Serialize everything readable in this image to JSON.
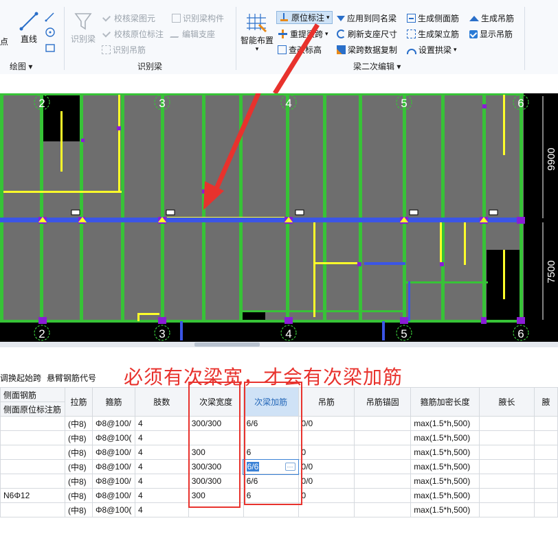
{
  "ribbon": {
    "groups": {
      "draw": {
        "label": "绘图",
        "items": {
          "line": "直线"
        },
        "partial_left": "点"
      },
      "identify": {
        "label": "识别梁",
        "items": {
          "identify_beam": "识别梁",
          "check_beam_graphic": "校核梁图元",
          "check_original_annotation": "校核原位标注",
          "identify_hanger": "识别吊筋",
          "identify_beam_component": "识别梁构件",
          "edit_support": "编辑支座"
        }
      },
      "secondary_edit": {
        "label": "梁二次编辑",
        "items": {
          "smart_layout": "智能布置",
          "original_annotation": "原位标注",
          "reextract_span": "重提梁跨",
          "check_elevation": "查改标高",
          "apply_same_name": "应用到同名梁",
          "refresh_support_size": "刷新支座尺寸",
          "copy_beam_data": "梁跨数据复制",
          "generate_side_rebar": "生成侧面筋",
          "generate_stand_rebar": "生成架立筋",
          "set_arch_beam": "设置拱梁",
          "generate_hanger": "生成吊筋",
          "show_hanger": "显示吊筋"
        }
      }
    }
  },
  "canvas": {
    "axis_labels_top": [
      "2",
      "3",
      "4",
      "5",
      "6"
    ],
    "axis_labels_bottom": [
      "2",
      "3",
      "4",
      "5",
      "6"
    ],
    "dimensions": [
      "9900",
      "7500"
    ]
  },
  "annotation": "必须有次梁宽，才会有次梁加筋",
  "grid": {
    "toolbar": [
      "调换起始跨",
      "悬臂钢筋代号"
    ],
    "group_header": "侧面钢筋",
    "columns": [
      "侧面原位标注筋",
      "拉筋",
      "箍筋",
      "肢数",
      "次梁宽度",
      "次梁加筋",
      "吊筋",
      "吊筋锚固",
      "箍筋加密长度",
      "腋长",
      "腋"
    ],
    "rows": [
      {
        "side": "",
        "tie": "(中8)",
        "stirrup": "Φ8@100/",
        "legs": "4",
        "sec_width": "300/300",
        "sec_rebar": "6/6",
        "hanger": "0/0",
        "anchor": "",
        "dense": "max(1.5*h,500)"
      },
      {
        "side": "",
        "tie": "(中8)",
        "stirrup": "Φ8@100(",
        "legs": "4",
        "sec_width": "",
        "sec_rebar": "",
        "hanger": "",
        "anchor": "",
        "dense": "max(1.5*h,500)"
      },
      {
        "side": "",
        "tie": "(中8)",
        "stirrup": "Φ8@100/",
        "legs": "4",
        "sec_width": "300",
        "sec_rebar": "6",
        "hanger": "0",
        "anchor": "",
        "dense": "max(1.5*h,500)"
      },
      {
        "side": "",
        "tie": "(中8)",
        "stirrup": "Φ8@100/",
        "legs": "4",
        "sec_width": "300/300",
        "sec_rebar": "6/6",
        "hanger": "0/0",
        "anchor": "",
        "dense": "max(1.5*h,500)"
      },
      {
        "side": "",
        "tie": "(中8)",
        "stirrup": "Φ8@100/",
        "legs": "4",
        "sec_width": "300/300",
        "sec_rebar": "6/6",
        "hanger": "0/0",
        "anchor": "",
        "dense": "max(1.5*h,500)"
      },
      {
        "side": "N6Φ12",
        "tie": "(中8)",
        "stirrup": "Φ8@100/",
        "legs": "4",
        "sec_width": "300",
        "sec_rebar": "6",
        "hanger": "0",
        "anchor": "",
        "dense": "max(1.5*h,500)"
      },
      {
        "side": "",
        "tie": "(中8)",
        "stirrup": "Φ8@100(",
        "legs": "4",
        "sec_width": "",
        "sec_rebar": "",
        "hanger": "",
        "anchor": "",
        "dense": "max(1.5*h,500)"
      }
    ]
  },
  "colors": {
    "annotation": "#e8322d",
    "beam_green": "#37c337",
    "beam_yellow": "#ffff2a",
    "beam_blue": "#3b55e6",
    "node_purple": "#8a1dd6",
    "slab_gray": "#6e6e6e"
  }
}
